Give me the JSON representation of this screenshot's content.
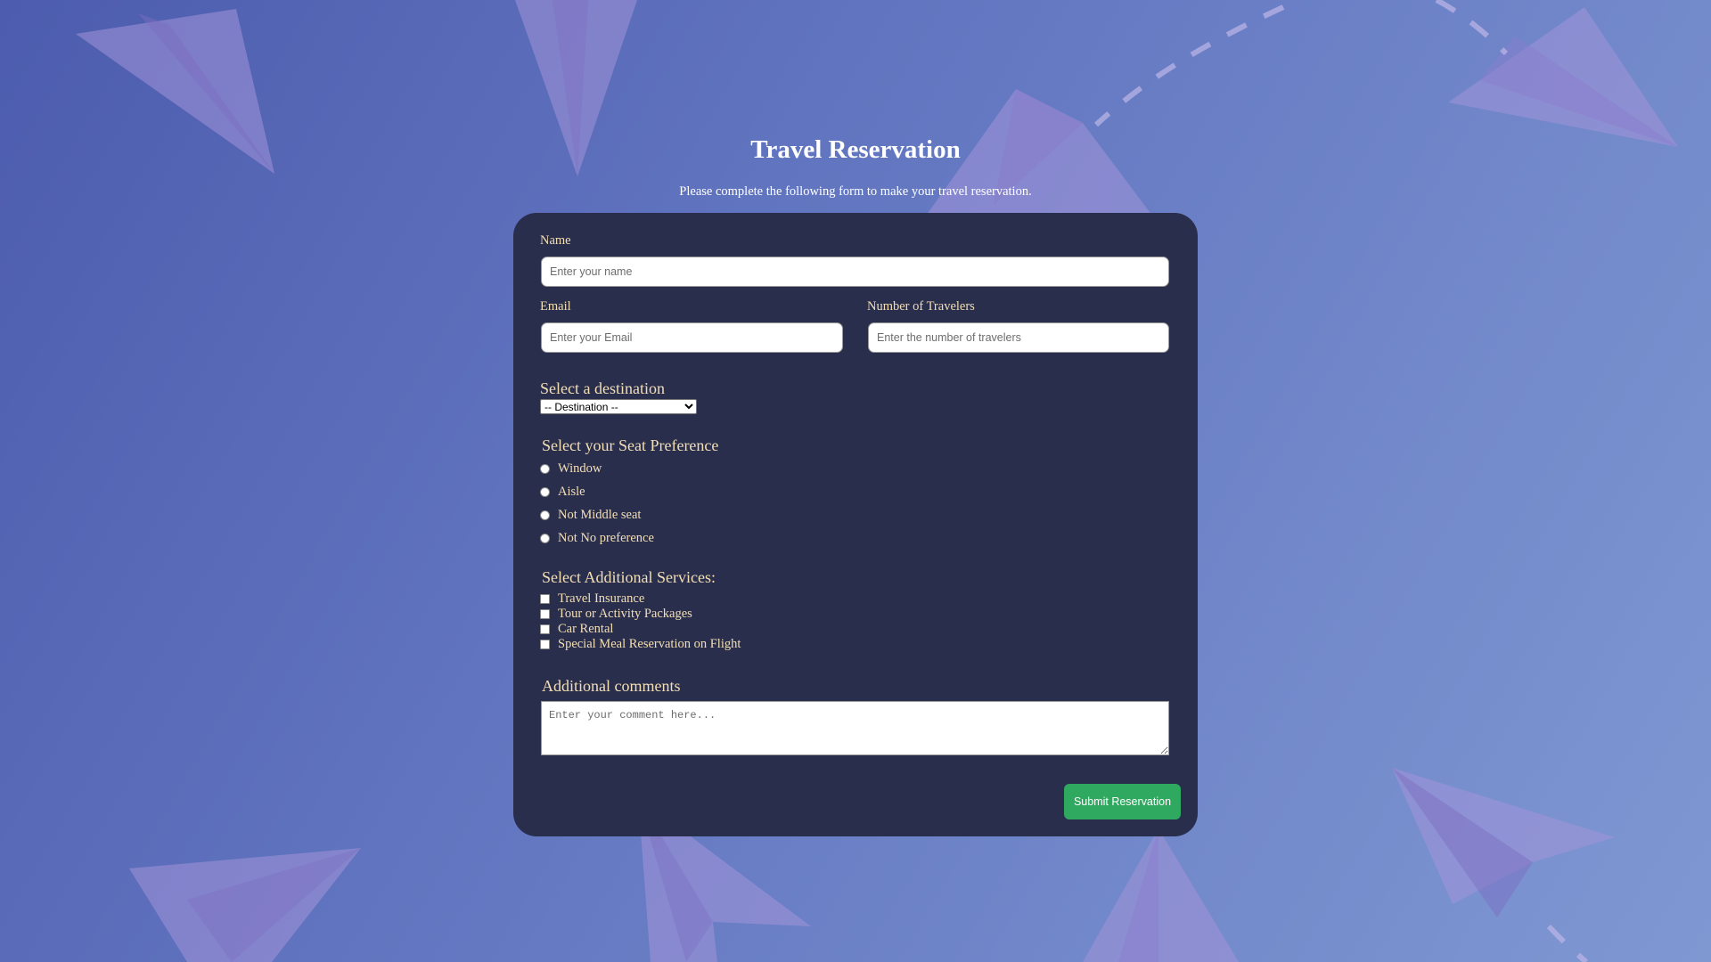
{
  "page": {
    "title": "Travel Reservation",
    "subtitle": "Please complete the following form to make your travel reservation."
  },
  "form": {
    "name": {
      "label": "Name",
      "placeholder": "Enter your name",
      "value": ""
    },
    "email": {
      "label": "Email",
      "placeholder": "Enter your Email",
      "value": ""
    },
    "travelers": {
      "label": "Number of Travelers",
      "placeholder": "Enter the number of travelers",
      "value": ""
    },
    "destination": {
      "label": "Select a destination",
      "selected": "-- Destination --"
    },
    "seat": {
      "label": "Select your Seat Preference",
      "options": [
        "Window",
        "Aisle",
        "Not Middle seat",
        "Not No preference"
      ]
    },
    "services": {
      "label": "Select Additional Services:",
      "options": [
        "Travel Insurance",
        "Tour or Activity Packages",
        "Car Rental",
        "Special Meal Reservation on Flight"
      ]
    },
    "comments": {
      "label": "Additional comments",
      "placeholder": "Enter your comment here...",
      "value": ""
    },
    "submit_label": "Submit Reservation"
  },
  "colors": {
    "card_background": "#2a2e4d",
    "label_text": "#f3dfb5",
    "submit_button": "#2fa860",
    "background_start": "#4d5cae",
    "background_end": "#7f98d2",
    "paper_plane": "#9b8fd6"
  },
  "decorations": {
    "icon": "paper-plane-icon",
    "count": 9
  }
}
